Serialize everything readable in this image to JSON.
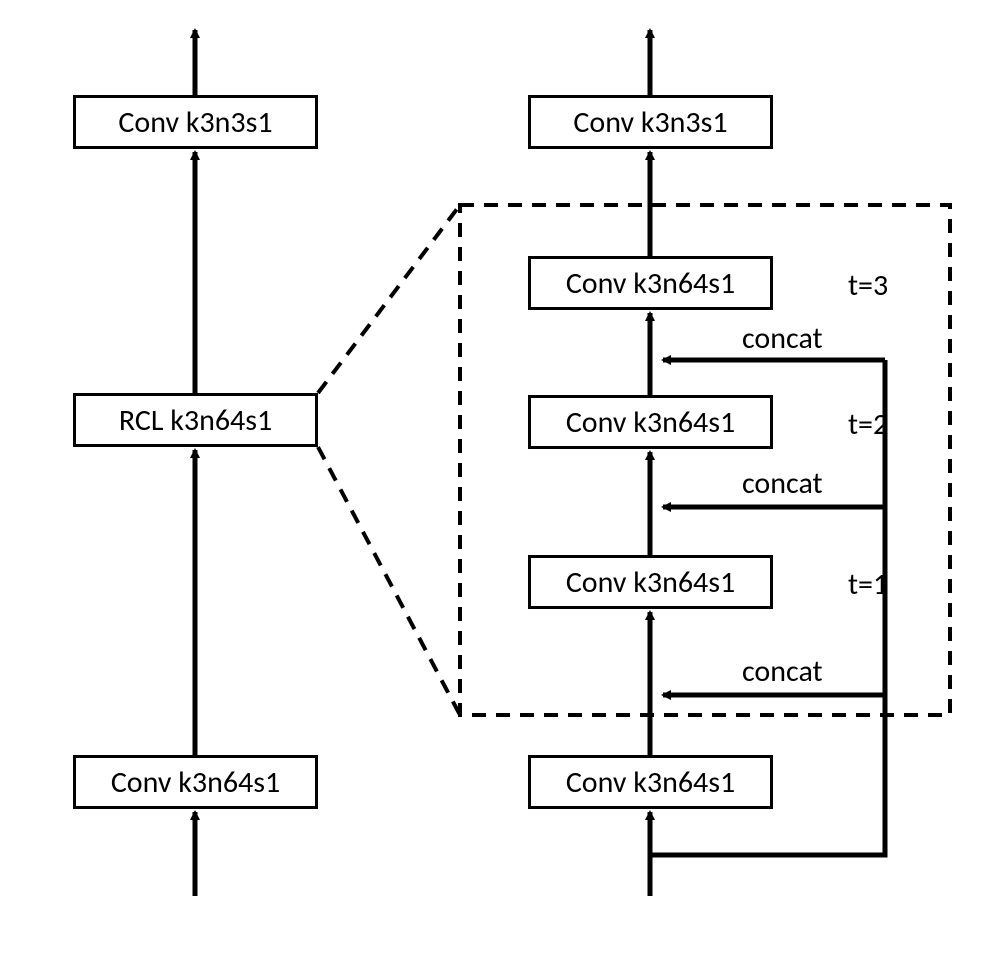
{
  "left": {
    "top": "Conv k3n3s1",
    "middle": "RCL k3n64s1",
    "bottom": "Conv k3n64s1"
  },
  "right": {
    "top": "Conv k3n3s1",
    "r3": "Conv k3n64s1",
    "r2": "Conv k3n64s1",
    "r1": "Conv k3n64s1",
    "bottom": "Conv k3n64s1"
  },
  "labels": {
    "t3": "t=3",
    "t2": "t=2",
    "t1": "t=1",
    "concat": "concat"
  }
}
